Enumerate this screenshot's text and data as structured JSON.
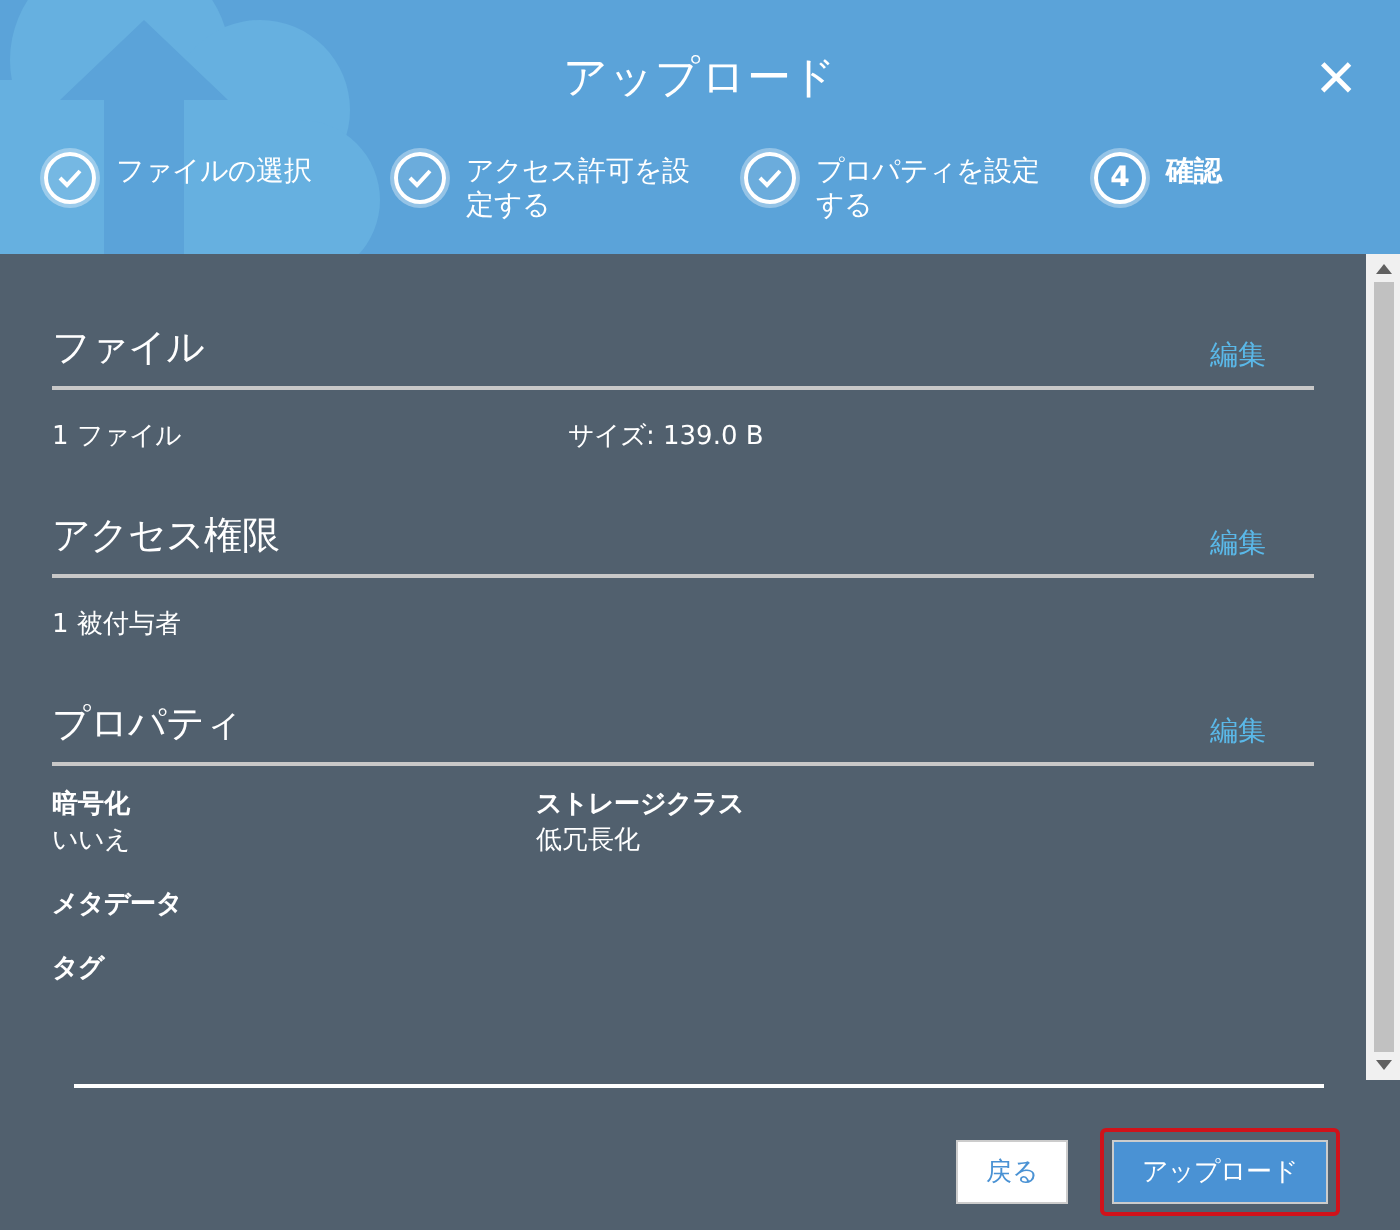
{
  "dialog": {
    "title": "アップロード",
    "close": "×"
  },
  "steps": [
    {
      "label": "ファイルの選択",
      "completed": true,
      "selected": false
    },
    {
      "label": "アクセス許可を設定する",
      "completed": true,
      "selected": false
    },
    {
      "label": "プロパティを設定する",
      "completed": true,
      "selected": false
    },
    {
      "label": "確認",
      "number": "4",
      "completed": false,
      "selected": true
    }
  ],
  "sections": [
    {
      "title": "ファイル",
      "edit": "編集",
      "kind": "pairs",
      "items": [
        {
          "label": "1 ファイル"
        },
        {
          "label": "サイズ: 139.0 B"
        }
      ]
    },
    {
      "title": "アクセス権限",
      "edit": "編集",
      "kind": "pairs",
      "items": [
        {
          "label": "1 被付与者"
        }
      ]
    },
    {
      "title": "プロパティ",
      "edit": "編集",
      "kind": "fields",
      "items": [
        {
          "label": "暗号化",
          "value": "いいえ"
        },
        {
          "label": "ストレージクラス",
          "value": "低冗長化"
        },
        {
          "label": "メタデータ"
        },
        {
          "label": "タグ"
        }
      ]
    }
  ],
  "buttons": [
    {
      "label": "戻る",
      "kind": "secondary",
      "highlighted": false
    },
    {
      "label": "アップロード",
      "kind": "primary",
      "highlighted": true
    }
  ]
}
